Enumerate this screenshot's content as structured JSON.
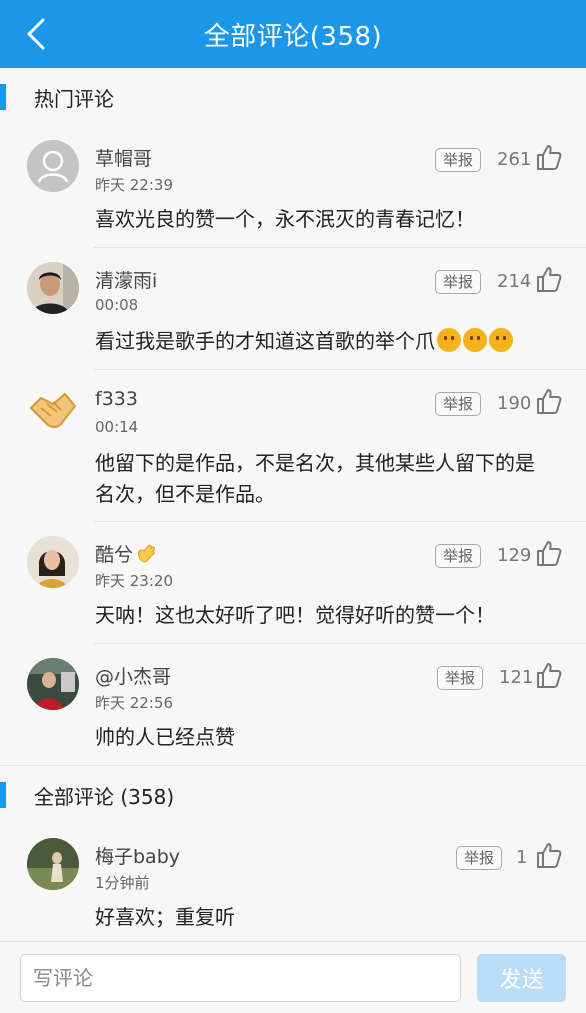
{
  "header": {
    "title": "全部评论(358)"
  },
  "hot_section": {
    "title": "热门评论"
  },
  "hot_comments": [
    {
      "user": "草帽哥",
      "time": "昨天 22:39",
      "likes": "261",
      "text": "喜欢光良的赞一个，永不泯灭的青春记忆！",
      "report": "举报"
    },
    {
      "user": "清濛雨i",
      "time": "00:08",
      "likes": "214",
      "text": "看过我是歌手的才知道这首歌的举个爪",
      "report": "举报"
    },
    {
      "user": "f333",
      "time": "00:14",
      "likes": "190",
      "text": "他留下的是作品，不是名次，其他某些人留下的是名次，但不是作品。",
      "report": "举报"
    },
    {
      "user": "酷兮",
      "time": "昨天 23:20",
      "likes": "129",
      "text": "天呐！这也太好听了吧！觉得好听的赞一个！",
      "report": "举报"
    },
    {
      "user": "@小杰哥",
      "time": "昨天 22:56",
      "likes": "121",
      "text": "帅的人已经点赞",
      "report": "举报"
    }
  ],
  "all_section": {
    "title": "全部评论 (358)"
  },
  "all_comments": [
    {
      "user": "梅子baby",
      "time": "1分钟前",
      "likes": "1",
      "text": "好喜欢；重复听",
      "report": "举报"
    }
  ],
  "footer": {
    "placeholder": "写评论",
    "send_label": "发送"
  },
  "colors": {
    "accent": "#1b97ea",
    "send_disabled": "#b9dcf7"
  }
}
